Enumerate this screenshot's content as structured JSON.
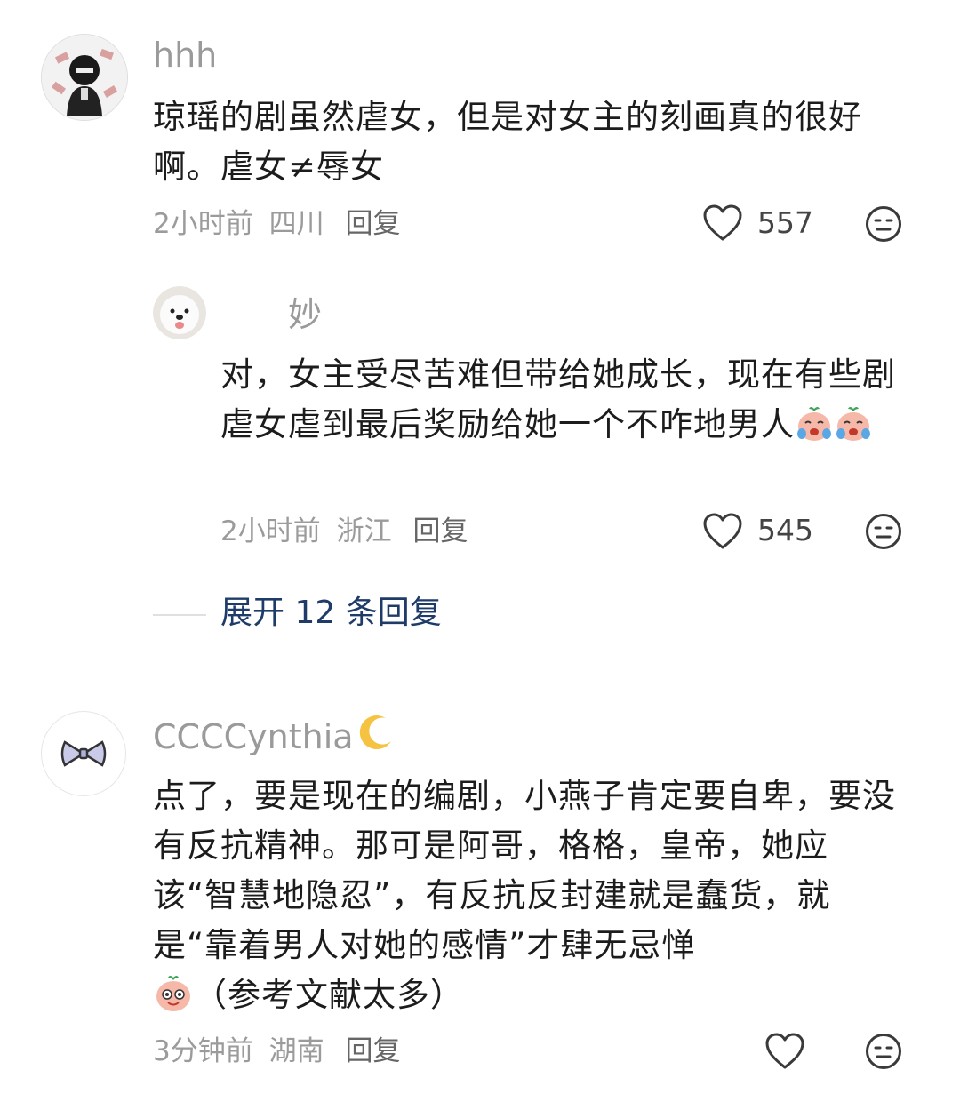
{
  "comments": [
    {
      "name": "hhh",
      "text": "琼瑶的剧虽然虐女，但是对女主的刻画真的很好啊。虐女≠辱女",
      "time": "2小时前",
      "location": "四川",
      "reply_label": "回复",
      "likes": "557"
    },
    {
      "name": "妙",
      "text": "对，女主受尽苦难但带给她成长，现在有些剧虐女虐到最后奖励给她一个不咋地男人",
      "time": "2小时前",
      "location": "浙江",
      "reply_label": "回复",
      "likes": "545"
    },
    {
      "name": "CCCCynthia",
      "text_part1": "点了，要是现在的编剧，小燕子肯定要自卑，要没有反抗精神。那可是阿哥，格格，皇帝，她应该“智慧地隐忍”，有反抗反封建就是蠢货，就是“靠着男人对她的感情”才肆无忌惮",
      "text_part2": "（参考文献太多）",
      "time": "3分钟前",
      "location": "湖南",
      "reply_label": "回复",
      "likes": ""
    }
  ],
  "expand_replies": "展开 12 条回复",
  "icons": {
    "like": "heart-outline-icon",
    "dislike": "meh-face-icon",
    "moon": "crescent-moon-icon"
  },
  "colors": {
    "expand_link": "#1f3c68",
    "meta_gray": "#9b9b9b"
  }
}
